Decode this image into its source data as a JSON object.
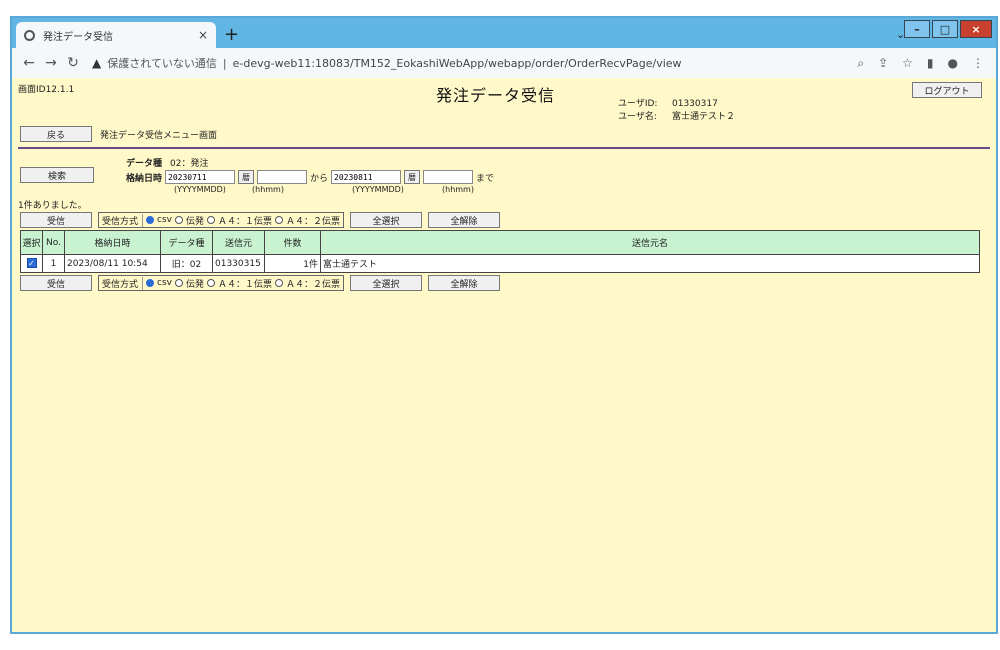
{
  "browser": {
    "tab_title": "発注データ受信",
    "tab_close": "×",
    "new_tab": "+",
    "url_warning": "保護されていない通信",
    "url": "e-devg-web11:18083/TM152_EokashiWebApp/webapp/order/OrderRecvPage/view"
  },
  "page": {
    "screen_id": "画面ID12.1.1",
    "title": "発注データ受信",
    "logout": "ログアウト",
    "user_id_label": "ユーザID:",
    "user_id": "01330317",
    "user_name_label": "ユーザ名:",
    "user_name": "富士通テスト２",
    "back_button": "戻る",
    "menu_name": "発注データ受信メニュー画面",
    "search_button": "検索",
    "data_kind_label": "データ種",
    "data_kind_value": "02：発注",
    "date_label": "格納日時",
    "date_from": "20230711",
    "date_to": "20230811",
    "cal_label": "暦",
    "kara": "から",
    "made": "まで",
    "date_format": "(YYYYMMDD)",
    "time_format": "(hhmm)",
    "result_count": "1件ありました。"
  },
  "actions": {
    "receive_button": "受信",
    "method_label": "受信方式",
    "options": [
      "csv",
      "伝発",
      "Ａ４：１伝票",
      "Ａ４：２伝票"
    ],
    "select_all": "全選択",
    "deselect_all": "全解除"
  },
  "table": {
    "headers": [
      "選択",
      "No.",
      "格納日時",
      "データ種",
      "送信元",
      "件数",
      "送信元名"
    ],
    "rows": [
      {
        "no": "1",
        "date": "2023/08/11 10:54",
        "kind": "旧：02",
        "sender": "01330315",
        "count": "1件",
        "sender_name": "富士通テスト"
      }
    ]
  }
}
